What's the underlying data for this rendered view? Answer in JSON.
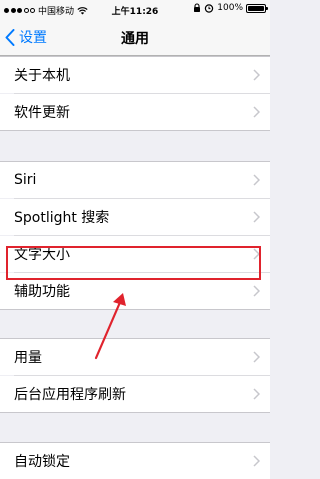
{
  "status_bar": {
    "carrier": "中国移动",
    "time": "上午11:26",
    "battery": "100%",
    "battery_level": 1.0
  },
  "nav": {
    "back_label": "设置",
    "title": "通用"
  },
  "rows": {
    "about": "关于本机",
    "software_update": "软件更新",
    "siri": "Siri",
    "spotlight": "Spotlight 搜索",
    "text_size": "文字大小",
    "accessibility": "辅助功能",
    "usage": "用量",
    "background_refresh": "后台应用程序刷新",
    "auto_lock": "自动锁定"
  },
  "colors": {
    "accent": "#007aff",
    "highlight": "#e0232d",
    "background": "#efeff4"
  },
  "icons": [
    "chevron-left-icon",
    "chevron-right-icon",
    "wifi-icon",
    "lock-icon",
    "alarm-icon",
    "battery-icon",
    "annotation-arrow"
  ]
}
